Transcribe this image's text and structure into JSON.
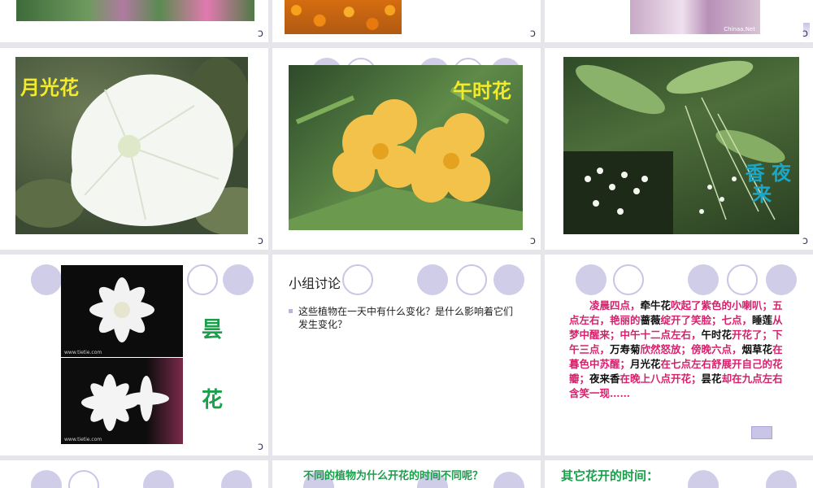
{
  "slides": {
    "s2": {
      "watermark": "Chinaa.Net"
    },
    "s3": {
      "label": "月光花"
    },
    "s4": {
      "label": "午时花"
    },
    "s5": {
      "label": "香 夜\n 来"
    },
    "s6": {
      "label_top": "昙",
      "label_bottom": "花",
      "credit": "www.tietie.com"
    },
    "s7": {
      "title": "小组讨论",
      "bullet": "这些植物在一天中有什么变化？是什么影响着它们发生变化？"
    },
    "s8": {
      "poem": [
        {
          "t": "凌晨四点，",
          "c": "m"
        },
        {
          "t": "牵牛花",
          "c": "k"
        },
        {
          "t": "吹起了紫色的小喇叭；五点左右，艳丽的",
          "c": "m"
        },
        {
          "t": "蔷薇",
          "c": "k"
        },
        {
          "t": "绽开了笑脸；七点，",
          "c": "m"
        },
        {
          "t": "睡莲",
          "c": "k"
        },
        {
          "t": "从梦中醒来；中午十二点左右，",
          "c": "m"
        },
        {
          "t": "午时花",
          "c": "k"
        },
        {
          "t": "开花了；下午三点，",
          "c": "m"
        },
        {
          "t": "万寿菊",
          "c": "k"
        },
        {
          "t": "欣然怒放；傍晚六点，",
          "c": "m"
        },
        {
          "t": "烟草花",
          "c": "k"
        },
        {
          "t": "在暮色中苏醒；",
          "c": "m"
        },
        {
          "t": "月光花",
          "c": "k"
        },
        {
          "t": "在七点左右舒展开自己的花瓣；",
          "c": "m"
        },
        {
          "t": "夜来香",
          "c": "k"
        },
        {
          "t": "在晚上八点开花；",
          "c": "m"
        },
        {
          "t": "昙花",
          "c": "k"
        },
        {
          "t": "却在九点左右含笑一现……",
          "c": "m"
        }
      ]
    },
    "s10": {
      "question": "不同的植物为什么开花的时间不同呢？"
    },
    "s11": {
      "title": "其它花开的时间："
    }
  },
  "colors": {
    "accent_circle": "#d0cde9",
    "label_yellow": "#f2ea2a",
    "label_teal": "#1aa7c8",
    "label_green": "#1aa04a",
    "poem_magenta": "#d8206c"
  }
}
